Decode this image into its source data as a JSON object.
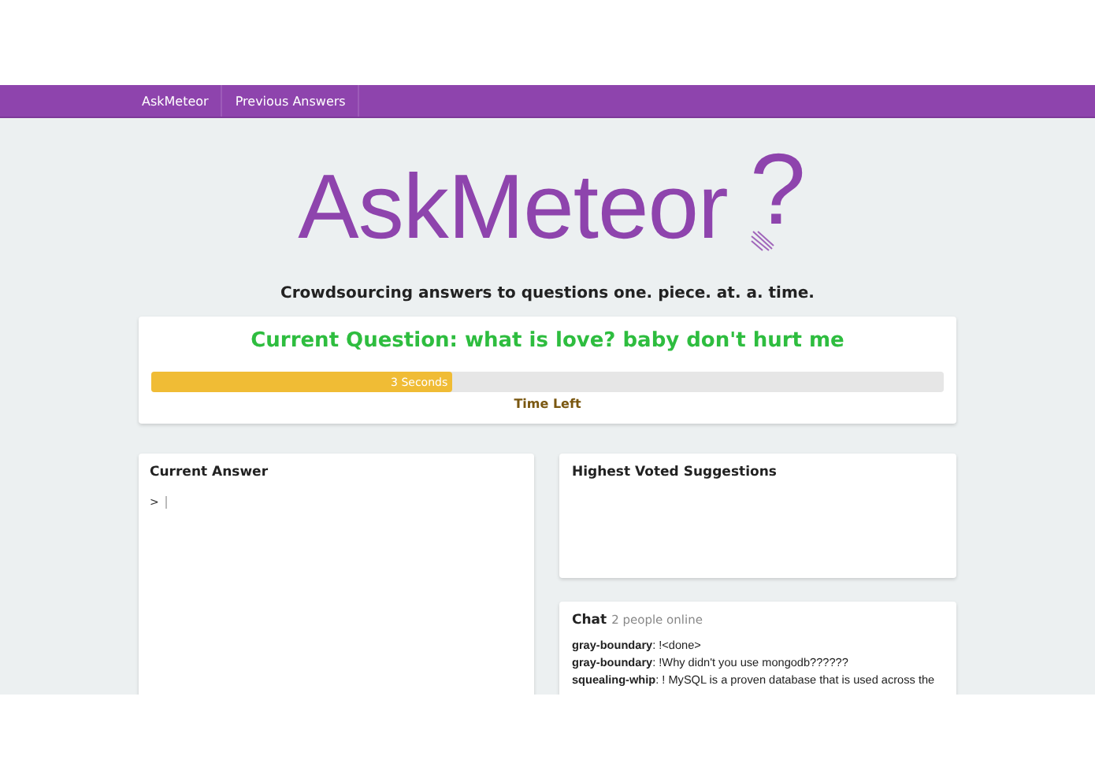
{
  "navbar": {
    "items": [
      {
        "label": "AskMeteor",
        "selected": false
      },
      {
        "label": "Previous Answers",
        "selected": false
      }
    ]
  },
  "logo": {
    "text": "AskMeteor",
    "mark": "?"
  },
  "tagline": "Crowdsourcing answers to questions one. piece. at. a. time.",
  "question": {
    "title": "Current Question: what is love? baby don't hurt me",
    "timer": {
      "level": 0.38,
      "reading": "3 Seconds",
      "label": "Time Left"
    }
  },
  "answer": {
    "title": "Current Answer",
    "prompt": ">"
  },
  "suggestions": {
    "title": "Highest Voted Suggestions"
  },
  "chat": {
    "title": "Chat",
    "status": "2 people online",
    "messages": [
      {
        "user": "gray-boundary",
        "text": ": !<done>"
      },
      {
        "user": "gray-boundary",
        "text": ": !Why didn't you use mongodb??????"
      },
      {
        "user": "squealing-whip",
        "text": ": ! MySQL is a proven database that is used across the"
      }
    ]
  }
}
